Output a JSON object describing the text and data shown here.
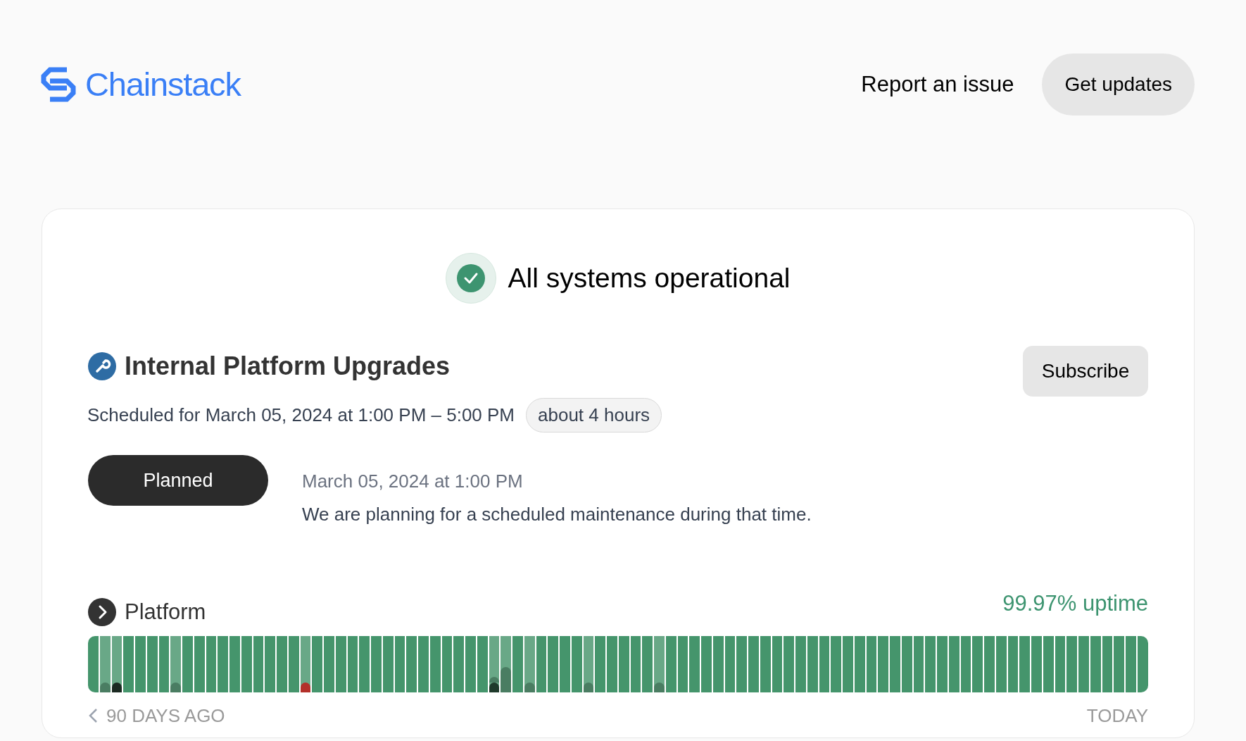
{
  "header": {
    "brand": "Chainstack",
    "links": [
      "Report an issue"
    ],
    "cta": "Get updates"
  },
  "status": {
    "title": "All systems operational"
  },
  "maintenance": {
    "title": "Internal Platform Upgrades",
    "subscribe": "Subscribe",
    "schedule": "Scheduled for March 05, 2024 at 1:00 PM – 5:00 PM",
    "duration": "about 4 hours",
    "updates": [
      {
        "label": "Planned",
        "time": "March 05, 2024 at 1:00 PM",
        "message": "We are planning for a scheduled maintenance during that time."
      }
    ]
  },
  "components": [
    {
      "name": "Platform",
      "expanded": false,
      "uptime": "99.97% uptime",
      "start_label": "90 DAYS AGO",
      "end_label": "TODAY",
      "days": [
        {
          "kind": "ok"
        },
        {
          "kind": "minor"
        },
        {
          "kind": "major"
        },
        {
          "kind": "ok"
        },
        {
          "kind": "ok"
        },
        {
          "kind": "ok"
        },
        {
          "kind": "ok"
        },
        {
          "kind": "minor"
        },
        {
          "kind": "ok"
        },
        {
          "kind": "ok"
        },
        {
          "kind": "ok"
        },
        {
          "kind": "ok"
        },
        {
          "kind": "ok"
        },
        {
          "kind": "ok"
        },
        {
          "kind": "ok"
        },
        {
          "kind": "ok"
        },
        {
          "kind": "ok"
        },
        {
          "kind": "ok"
        },
        {
          "kind": "outage"
        },
        {
          "kind": "ok"
        },
        {
          "kind": "ok"
        },
        {
          "kind": "ok"
        },
        {
          "kind": "ok"
        },
        {
          "kind": "ok"
        },
        {
          "kind": "ok"
        },
        {
          "kind": "ok"
        },
        {
          "kind": "ok"
        },
        {
          "kind": "ok"
        },
        {
          "kind": "ok"
        },
        {
          "kind": "ok"
        },
        {
          "kind": "ok"
        },
        {
          "kind": "ok"
        },
        {
          "kind": "ok"
        },
        {
          "kind": "ok"
        },
        {
          "kind": "mixed"
        },
        {
          "kind": "partial"
        },
        {
          "kind": "ok"
        },
        {
          "kind": "minor"
        },
        {
          "kind": "ok"
        },
        {
          "kind": "ok"
        },
        {
          "kind": "ok"
        },
        {
          "kind": "ok"
        },
        {
          "kind": "minor"
        },
        {
          "kind": "ok"
        },
        {
          "kind": "ok"
        },
        {
          "kind": "ok"
        },
        {
          "kind": "ok"
        },
        {
          "kind": "ok"
        },
        {
          "kind": "minor"
        },
        {
          "kind": "ok"
        },
        {
          "kind": "ok"
        },
        {
          "kind": "ok"
        },
        {
          "kind": "ok"
        },
        {
          "kind": "ok"
        },
        {
          "kind": "ok"
        },
        {
          "kind": "ok"
        },
        {
          "kind": "ok"
        },
        {
          "kind": "ok"
        },
        {
          "kind": "ok"
        },
        {
          "kind": "ok"
        },
        {
          "kind": "ok"
        },
        {
          "kind": "ok"
        },
        {
          "kind": "ok"
        },
        {
          "kind": "ok"
        },
        {
          "kind": "ok"
        },
        {
          "kind": "ok"
        },
        {
          "kind": "ok"
        },
        {
          "kind": "ok"
        },
        {
          "kind": "ok"
        },
        {
          "kind": "ok"
        },
        {
          "kind": "ok"
        },
        {
          "kind": "ok"
        },
        {
          "kind": "ok"
        },
        {
          "kind": "ok"
        },
        {
          "kind": "ok"
        },
        {
          "kind": "ok"
        },
        {
          "kind": "ok"
        },
        {
          "kind": "ok"
        },
        {
          "kind": "ok"
        },
        {
          "kind": "ok"
        },
        {
          "kind": "ok"
        },
        {
          "kind": "ok"
        },
        {
          "kind": "ok"
        },
        {
          "kind": "ok"
        },
        {
          "kind": "ok"
        },
        {
          "kind": "ok"
        },
        {
          "kind": "ok"
        },
        {
          "kind": "ok"
        },
        {
          "kind": "ok"
        },
        {
          "kind": "ok"
        }
      ]
    }
  ]
}
